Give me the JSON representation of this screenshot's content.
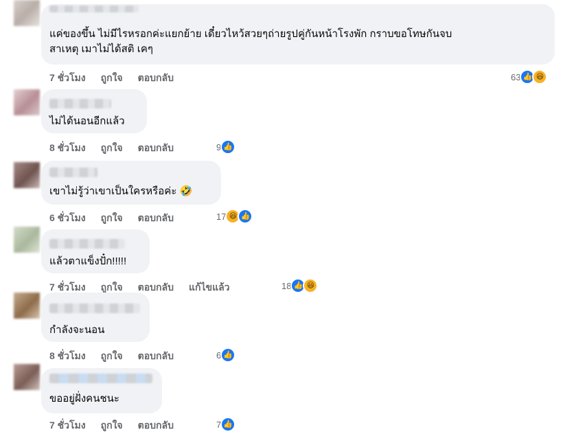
{
  "comments": [
    {
      "text": "แค่ของขึ้น ไม่มีไรหรอกค่ะแยกย้าย เดี๋ยวไหว้สวยๆถ่ายรูปคู่กันหน้าโรงพัก กราบขอโทษกันจบ\nสาเหตุ เมาไม่ได้สติ เคๆ",
      "time": "7 ชั่วโมง",
      "like": "ถูกใจ",
      "reply": "ตอบกลับ",
      "edited": "",
      "count": "63",
      "icons": [
        "like-icon",
        "haha-icon"
      ]
    },
    {
      "text": "ไม่ได้นอนอีกแล้ว",
      "time": "8 ชั่วโมง",
      "like": "ถูกใจ",
      "reply": "ตอบกลับ",
      "edited": "",
      "count": "9",
      "icons": [
        "like-icon"
      ]
    },
    {
      "text": "เขาไม่รู้ว่าเขาเป็นใครหรือค่ะ 🤣",
      "time": "6 ชั่วโมง",
      "like": "ถูกใจ",
      "reply": "ตอบกลับ",
      "edited": "",
      "count": "17",
      "icons": [
        "haha-icon",
        "like-icon"
      ]
    },
    {
      "text": "แล้วตาแข็งปั๋ก!!!!!",
      "time": "7 ชั่วโมง",
      "like": "ถูกใจ",
      "reply": "ตอบกลับ",
      "edited": "แก้ไขแล้ว",
      "count": "18",
      "icons": [
        "like-icon",
        "haha-icon"
      ]
    },
    {
      "text": "กำลังจะนอน",
      "time": "8 ชั่วโมง",
      "like": "ถูกใจ",
      "reply": "ตอบกลับ",
      "edited": "",
      "count": "6",
      "icons": [
        "like-icon"
      ]
    },
    {
      "text": "ขออยู่ฝั่งคนชนะ",
      "time": "7 ชั่วโมง",
      "like": "ถูกใจ",
      "reply": "ตอบกลับ",
      "edited": "",
      "count": "7",
      "icons": [
        "like-icon"
      ]
    }
  ]
}
